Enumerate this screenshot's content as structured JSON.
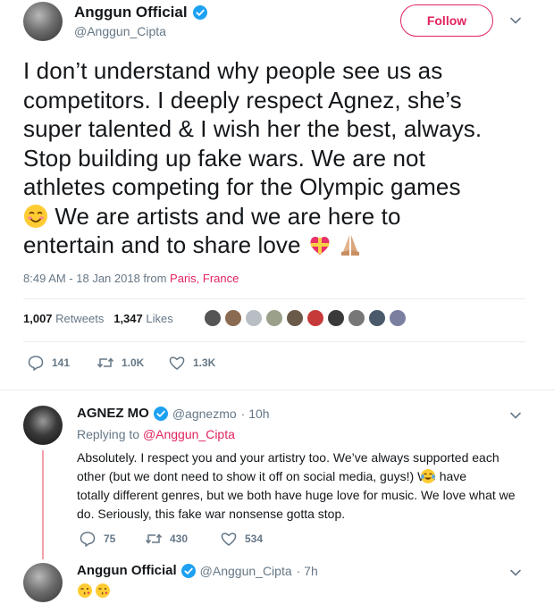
{
  "tweet": {
    "author_name": "Anggun Official",
    "author_handle": "@Anggun_Cipta",
    "follow_label": "Follow",
    "text_lines": [
      "I don’t understand why people see us as",
      "competitors. I deeply respect Agnez, she’s",
      "super talented & I wish her the best, always.",
      "Stop building up fake wars. We are not",
      "athletes competing for the Olympic games",
      " We are artists and we are here to",
      "entertain and to share love "
    ],
    "timestamp": "8:49 AM - 18 Jan 2018 from ",
    "location": "Paris, France",
    "retweets_count": "1,007",
    "retweets_label": "Retweets",
    "likes_count": "1,347",
    "likes_label": "Likes",
    "actions": {
      "replies": "141",
      "retweets": "1.0K",
      "likes": "1.3K"
    }
  },
  "reply1": {
    "author_name": "AGNEZ MO",
    "author_handle": "@agnezmo",
    "time": " · 10h",
    "replying_prefix": "Replying to ",
    "replying_to": "@Anggun_Cipta",
    "text_lines": [
      "Absolutely. I respect you and your artistry too. We’ve always supported each",
      "other (but we dont need to show it off on social media, guys!)  We have",
      "totally different genres, but we both have huge love for music. We love what we",
      "do. Seriously, this fake war nonsense gotta stop."
    ],
    "actions": {
      "replies": "75",
      "retweets": "430",
      "likes": "534"
    }
  },
  "reply2": {
    "author_name": "Anggun Official",
    "author_handle": "@Anggun_Cipta",
    "time": " · 7h"
  },
  "colors": {
    "accent": "#e0245e",
    "verified": "#1da1f2",
    "muted": "#657786"
  }
}
